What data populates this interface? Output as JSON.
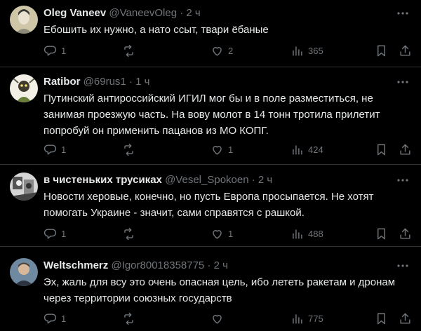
{
  "colors": {
    "background": "#000000",
    "text": "#e7e9ea",
    "muted": "#71767b",
    "divider": "#2f3336"
  },
  "tweets": [
    {
      "name": "Oleg Vaneev",
      "handle": "@VaneevOleg",
      "dot": "·",
      "time": "2 ч",
      "lines": [
        "Ебошить их нужно, а нато ссыт, твари ёбаные"
      ],
      "replies": "1",
      "retweets": "",
      "likes": "2",
      "views": "365",
      "avatar_icon": "portrait-avatar-icon"
    },
    {
      "name": "Ratibor",
      "handle": "@69rus1",
      "dot": "·",
      "time": "1 ч",
      "lines": [
        "Путинский антироссийский ИГИЛ мог бы и в поле разместиться, не",
        "занимая проезжую часть. На вову молот в 14 тонн тротила прилетит",
        "попробуй он применить пацанов из МО КОПГ."
      ],
      "replies": "1",
      "retweets": "",
      "likes": "1",
      "views": "424",
      "avatar_icon": "character-avatar-icon"
    },
    {
      "name": "в чистеньких трусиках",
      "handle": "@Vesel_Spokoen",
      "dot": "·",
      "time": "2 ч",
      "lines": [
        "Новости херовые, конечно, но пусть Европа просыпается. Не хотят",
        "помогать Украине - значит, сами справятся с рашкой."
      ],
      "replies": "1",
      "retweets": "",
      "likes": "1",
      "views": "488",
      "avatar_icon": "bw-photo-avatar-icon"
    },
    {
      "name": "Weltschmerz",
      "handle": "@Igor80018358775",
      "dot": "·",
      "time": "2 ч",
      "lines": [
        "Эх, жаль для всу это очень опасная цель, ибо лететь ракетам и дронам",
        "через территории союзных государств"
      ],
      "replies": "1",
      "retweets": "",
      "likes": "",
      "views": "775",
      "avatar_icon": "person-avatar-icon"
    }
  ]
}
